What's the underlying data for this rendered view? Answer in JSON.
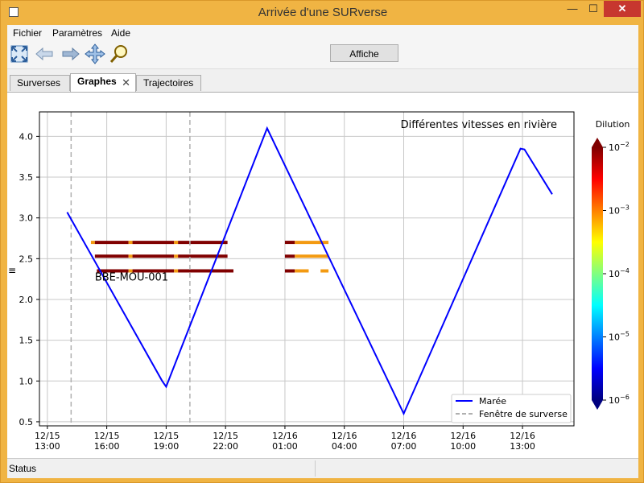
{
  "window": {
    "title": "Arrivée d'une SURverse",
    "controls": {
      "minimize": "—",
      "maximize": "☐",
      "close": "✕"
    }
  },
  "menu": {
    "items": [
      "Fichier",
      "Paramètres",
      "Aide"
    ]
  },
  "toolbar": {
    "icons": [
      "home-icon",
      "back-arrow-icon",
      "forward-arrow-icon",
      "pan-icon",
      "zoom-icon"
    ],
    "affiche_label": "Affiche"
  },
  "tabs": [
    {
      "label": "Surverses",
      "active": false
    },
    {
      "label": "Graphes",
      "active": true,
      "closable": true
    },
    {
      "label": "Trajectoires",
      "active": false
    }
  ],
  "status": {
    "text": "Status"
  },
  "colors": {
    "accent": "#f5b642",
    "tide_line": "#0000ff",
    "window_line": "#b0b0b0"
  },
  "chart_data": {
    "type": "line",
    "title": "Différentes vitesses en rivière",
    "x_ticks": [
      "12/15\n13:00",
      "12/15\n16:00",
      "12/15\n19:00",
      "12/15\n22:00",
      "12/16\n01:00",
      "12/16\n04:00",
      "12/16\n07:00",
      "12/16\n10:00",
      "12/16\n13:00"
    ],
    "x_tick_hours": [
      13,
      16,
      19,
      22,
      25,
      28,
      31,
      34,
      37
    ],
    "xlim_hours": [
      12.6,
      39.6
    ],
    "ylim": [
      0.45,
      4.3
    ],
    "y_ticks": [
      0.5,
      1.0,
      1.5,
      2.0,
      2.5,
      3.0,
      3.5,
      4.0
    ],
    "grid": true,
    "series": [
      {
        "name": "Marée",
        "x_hours": [
          14.0,
          18.8,
          19.0,
          24.1,
          31.0,
          36.9,
          37.1,
          38.5
        ],
        "y": [
          3.07,
          1.0,
          0.93,
          4.1,
          0.6,
          3.85,
          3.84,
          3.29
        ]
      }
    ],
    "surverse_window": {
      "name": "Fenêtre de surverse",
      "x_hours": [
        14.2,
        20.2
      ]
    },
    "station_label": "BBE-MOU-001",
    "station_label_anchor": {
      "x_hours": 15.4,
      "y": 2.23
    },
    "outflow_bars": [
      {
        "y": 2.7,
        "segments": [
          [
            15.2,
            15.4,
            "#f39a11"
          ],
          [
            15.4,
            17.1,
            "#800000"
          ],
          [
            17.1,
            17.3,
            "#f39a11"
          ],
          [
            17.3,
            19.4,
            "#800000"
          ],
          [
            19.4,
            19.6,
            "#f39a11"
          ],
          [
            19.6,
            22.1,
            "#800000"
          ]
        ]
      },
      {
        "y": 2.53,
        "segments": [
          [
            15.4,
            17.1,
            "#800000"
          ],
          [
            17.1,
            17.3,
            "#f39a11"
          ],
          [
            17.3,
            19.4,
            "#800000"
          ],
          [
            19.4,
            19.6,
            "#f39a11"
          ],
          [
            19.6,
            22.1,
            "#800000"
          ]
        ]
      },
      {
        "y": 2.35,
        "segments": [
          [
            15.5,
            17.1,
            "#800000"
          ],
          [
            17.1,
            17.3,
            "#f39a11"
          ],
          [
            17.3,
            19.4,
            "#800000"
          ],
          [
            19.4,
            19.6,
            "#f39a11"
          ],
          [
            19.6,
            22.4,
            "#800000"
          ]
        ]
      },
      {
        "y": 2.7,
        "segments": [
          [
            25.0,
            25.5,
            "#800000"
          ],
          [
            25.5,
            27.2,
            "#f39a11"
          ]
        ]
      },
      {
        "y": 2.53,
        "segments": [
          [
            25.0,
            25.5,
            "#800000"
          ],
          [
            25.5,
            27.2,
            "#f39a11"
          ]
        ]
      },
      {
        "y": 2.35,
        "segments": [
          [
            25.0,
            25.5,
            "#800000"
          ],
          [
            25.5,
            26.2,
            "#f39a11"
          ],
          [
            26.8,
            27.2,
            "#f39a11"
          ]
        ]
      }
    ],
    "colorbar": {
      "label": "Dilution",
      "scale": "log",
      "ticks": [
        {
          "base": "10",
          "exp": "−2"
        },
        {
          "base": "10",
          "exp": "−3"
        },
        {
          "base": "10",
          "exp": "−4"
        },
        {
          "base": "10",
          "exp": "−5"
        },
        {
          "base": "10",
          "exp": "−6"
        }
      ],
      "colormap": [
        "#00007f",
        "#0000ff",
        "#0080ff",
        "#00ffff",
        "#80ff80",
        "#ffff00",
        "#ff8000",
        "#ff0000",
        "#7f0000"
      ]
    },
    "legend": {
      "placement": "lower-right",
      "entries": [
        {
          "label": "Marée",
          "style": "solid",
          "color": "#0000ff"
        },
        {
          "label": "Fenêtre de surverse",
          "style": "dashed",
          "color": "#b0b0b0"
        }
      ]
    }
  }
}
